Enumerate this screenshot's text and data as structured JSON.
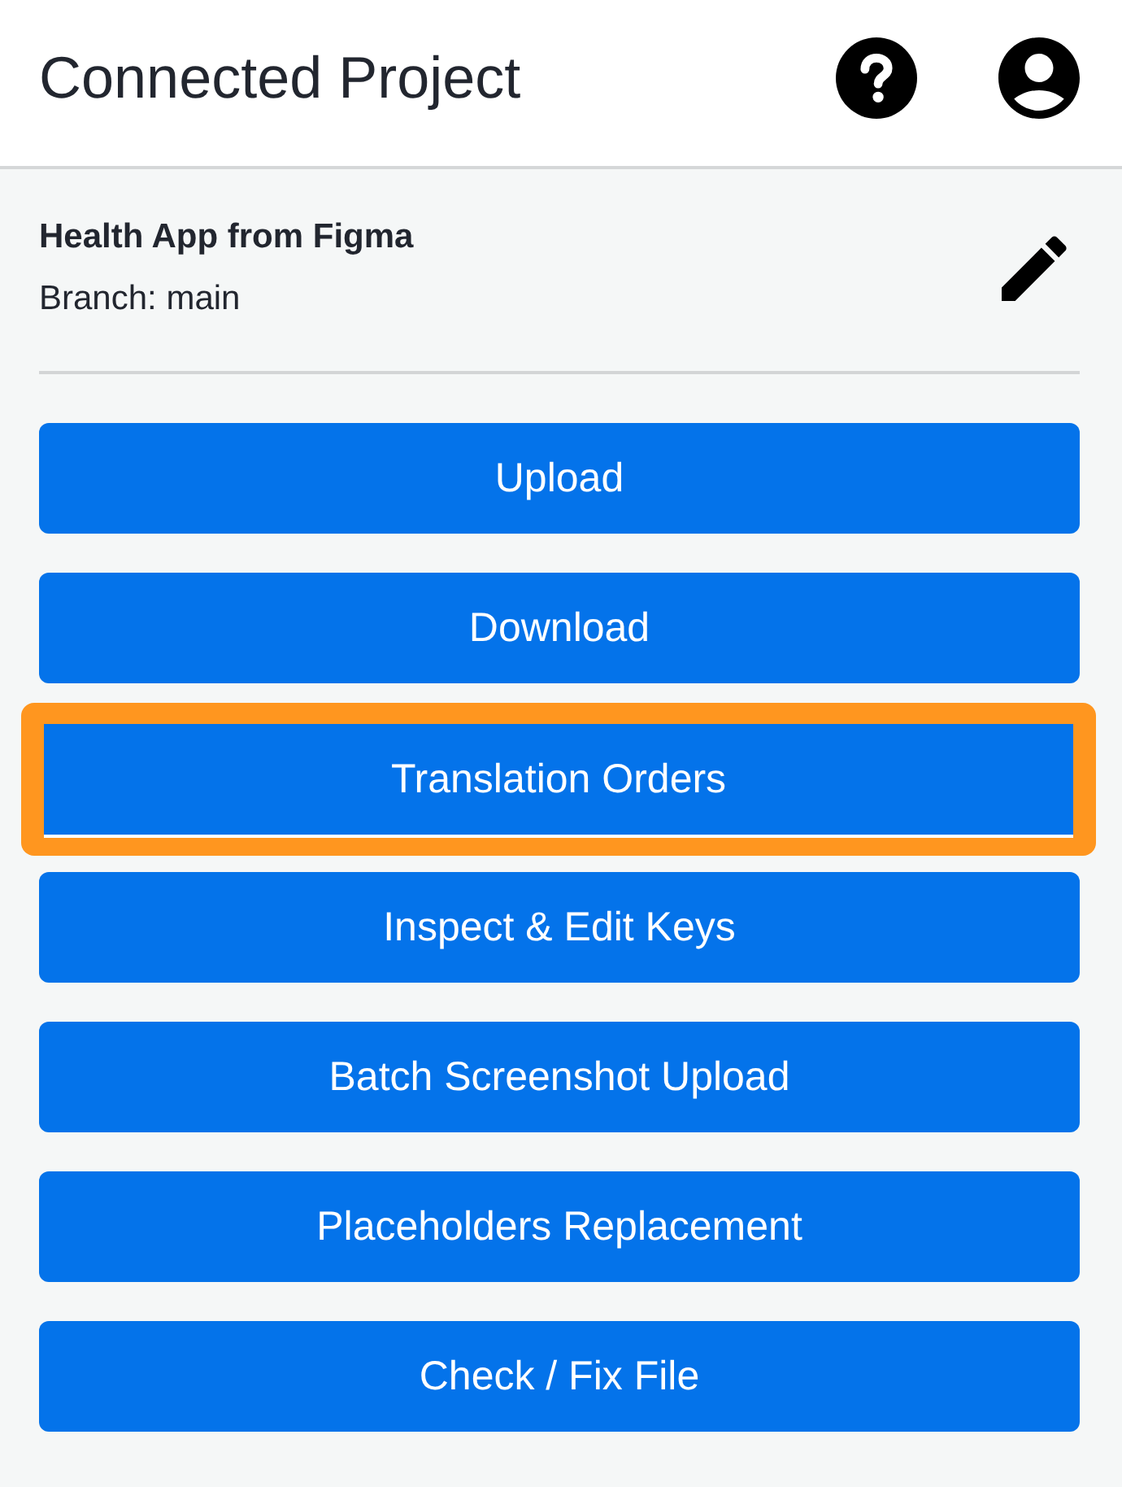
{
  "header": {
    "title": "Connected Project"
  },
  "project": {
    "name": "Health App from Figma",
    "branch": "Branch: main"
  },
  "actions": [
    {
      "label": "Upload",
      "highlighted": false
    },
    {
      "label": "Download",
      "highlighted": false
    },
    {
      "label": "Translation Orders",
      "highlighted": true
    },
    {
      "label": "Inspect & Edit Keys",
      "highlighted": false
    },
    {
      "label": "Batch Screenshot Upload",
      "highlighted": false
    },
    {
      "label": "Placeholders Replacement",
      "highlighted": false
    },
    {
      "label": "Check / Fix File",
      "highlighted": false
    }
  ]
}
